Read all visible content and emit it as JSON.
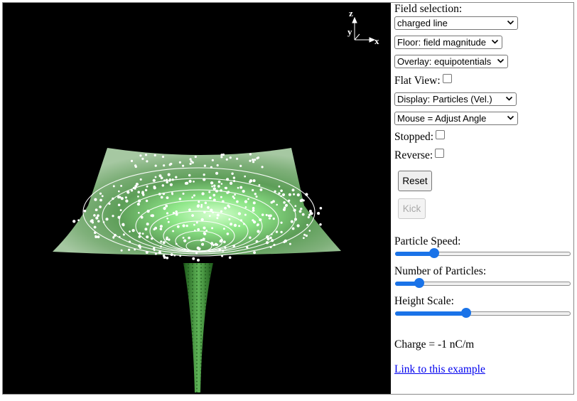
{
  "viewport": {
    "axes": {
      "z": "z",
      "y": "y",
      "x": "x"
    }
  },
  "panel": {
    "field_selection_label": "Field selection:",
    "field_select_value": "charged line",
    "floor_select_value": "Floor: field magnitude",
    "overlay_select_value": "Overlay: equipotentials",
    "flat_view_label": "Flat View:",
    "flat_view_checked": false,
    "display_select_value": "Display: Particles (Vel.)",
    "mouse_select_value": "Mouse = Adjust Angle",
    "stopped_label": "Stopped:",
    "stopped_checked": false,
    "reverse_label": "Reverse:",
    "reverse_checked": false,
    "reset_label": "Reset",
    "kick_label": "Kick",
    "kick_disabled": true,
    "particle_speed_label": "Particle Speed:",
    "particle_speed_fraction": 0.21,
    "num_particles_label": "Number of Particles:",
    "num_particles_fraction": 0.12,
    "height_scale_label": "Height Scale:",
    "height_scale_fraction": 0.405,
    "charge_text": "Charge = -1 nC/m",
    "link_text": "Link to this example"
  },
  "colors": {
    "accent": "#1a73e8",
    "surface_light": "#b9f0b0",
    "surface_dark": "#2f6a2c",
    "background": "#000000"
  }
}
